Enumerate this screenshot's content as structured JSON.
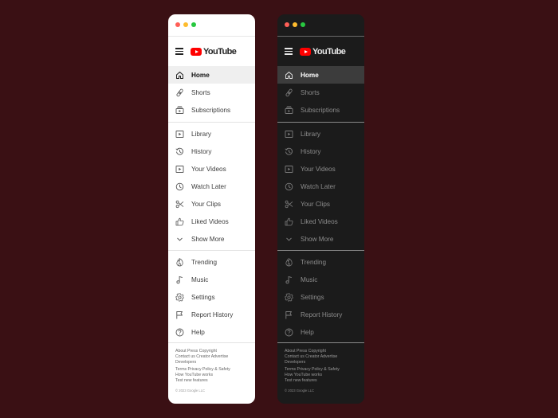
{
  "brand": {
    "name": "YouTube",
    "accent": "#ff0000"
  },
  "background": "#3a1014",
  "sections": {
    "main": [
      {
        "label": "Home",
        "icon": "home-icon"
      },
      {
        "label": "Shorts",
        "icon": "shorts-icon"
      },
      {
        "label": "Subscriptions",
        "icon": "subscriptions-icon"
      }
    ],
    "you": [
      {
        "label": "Library",
        "icon": "library-icon"
      },
      {
        "label": "History",
        "icon": "history-icon"
      },
      {
        "label": "Your Videos",
        "icon": "your-videos-icon"
      },
      {
        "label": "Watch Later",
        "icon": "watch-later-icon"
      },
      {
        "label": "Your Clips",
        "icon": "scissors-icon"
      },
      {
        "label": "Liked Videos",
        "icon": "thumbs-up-icon"
      },
      {
        "label": "Show More",
        "icon": "chevron-down-icon"
      }
    ],
    "explore": [
      {
        "label": "Trending",
        "icon": "trending-icon"
      },
      {
        "label": "Music",
        "icon": "music-icon"
      },
      {
        "label": "Settings",
        "icon": "gear-icon"
      },
      {
        "label": "Report History",
        "icon": "flag-icon"
      },
      {
        "label": "Help",
        "icon": "help-icon"
      }
    ]
  },
  "footer": {
    "line1": "About Press Copyright",
    "line2": "Contact us Creator Advertise",
    "line3": "Developers",
    "line4": "Terms Privacy Policy & Safety",
    "line5": "How YouTube works",
    "line6": "Test new features",
    "copyright": "© 2023 Google LLC"
  }
}
